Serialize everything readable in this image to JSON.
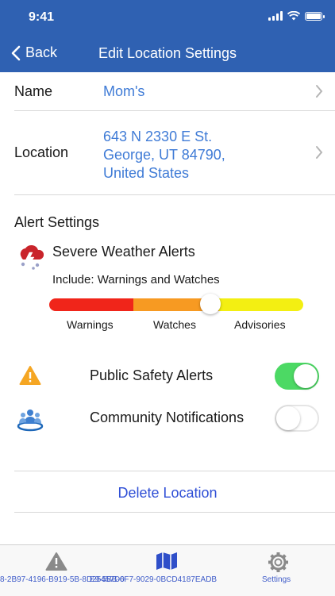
{
  "status_bar": {
    "time": "9:41"
  },
  "nav": {
    "back_label": "Back",
    "title": "Edit Location Settings"
  },
  "location": {
    "name_label": "Name",
    "name_value": "Mom's",
    "location_label": "Location",
    "address_line1": "643  N 2330 E St.",
    "address_line2": "George, UT 84790,",
    "address_line3": "United States"
  },
  "alerts": {
    "section_title": "Alert Settings",
    "severe_title": "Severe Weather Alerts",
    "include_text": "Include: Warnings and Watches",
    "slider_labels": [
      "Warnings",
      "Watches",
      "Advisories"
    ],
    "slider_selected": "Watches",
    "public_safety_label": "Public Safety Alerts",
    "public_safety_enabled": true,
    "community_label": "Community Notifications",
    "community_enabled": false
  },
  "actions": {
    "delete_label": "Delete Location"
  },
  "tabbar": {
    "tab1_label": "8-2B97-4196-B919-5B-8D25457D0",
    "tab2_label": "E9-5BB-6F7-9029-0BCD4187EADB",
    "tab3_label": "Settings"
  },
  "colors": {
    "header": "#2f61b2",
    "link": "#3f7bd6",
    "toggle_on": "#4cd964",
    "warnings": "#f0251a",
    "watches": "#f79a22",
    "advisories": "#f3ef12",
    "delete": "#2f4fd6"
  },
  "icons": {
    "weather": "severe-weather-icon",
    "public_safety": "warning-triangle-icon",
    "community": "community-people-icon"
  }
}
